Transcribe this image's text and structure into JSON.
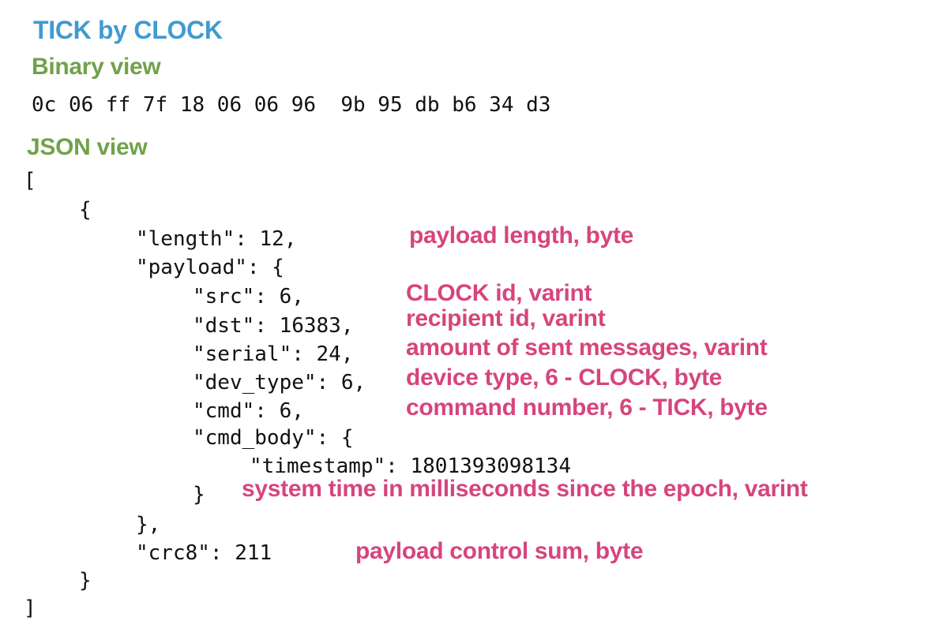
{
  "title": "TICK by CLOCK",
  "binary_view": {
    "heading": "Binary view",
    "bytes": "0c 06 ff 7f 18 06 06 96  9b 95 db b6 34 d3"
  },
  "json_view": {
    "heading": "JSON view",
    "lines": [
      "[",
      "{",
      "\"length\": 12,",
      "\"payload\": {",
      "\"src\": 6,",
      "\"dst\": 16383,",
      "\"serial\": 24,",
      "\"dev_type\": 6,",
      "\"cmd\": 6,",
      "\"cmd_body\": {",
      "\"timestamp\": 1801393098134",
      "}",
      "},",
      "\"crc8\": 211",
      "}",
      "]"
    ]
  },
  "annotations": [
    "payload length, byte",
    "CLOCK id, varint",
    "recipient id, varint",
    "amount of sent messages, varint",
    "device type, 6 - CLOCK, byte",
    "command number, 6 - TICK, byte",
    "system time in milliseconds since the epoch, varint",
    "payload control sum, byte"
  ]
}
